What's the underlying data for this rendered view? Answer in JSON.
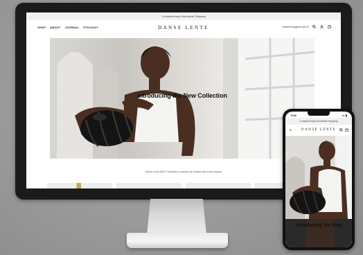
{
  "desktop": {
    "announcement": "Complimentary Worldwide Shipping",
    "nav": [
      "SHOP",
      "ABOUT",
      "JOURNAL",
      "STOCKIST"
    ],
    "brand": "DANSE LENTE",
    "language": "United Kingdom (£) ▾",
    "icons": [
      "search-icon",
      "account-icon",
      "bag-icon"
    ],
    "hero_title": "Introducing the New Collection",
    "tagline": "Danse Lente AW21 Collection is inspired by furniture and home objects"
  },
  "phone": {
    "time": "9:52",
    "signal": "▪▪▪ ▮",
    "announcement": "Complimentary Worldwide Shipping",
    "menu_icon": "≡",
    "brand": "DANSE LENTE",
    "icons": [
      "search-icon",
      "bag-icon"
    ],
    "hero_title": "Introducing the New"
  },
  "colors": {
    "bezel": "#1b1b1b",
    "background": "#9a9a9a",
    "announcement_bar": "#f1f1f1"
  }
}
